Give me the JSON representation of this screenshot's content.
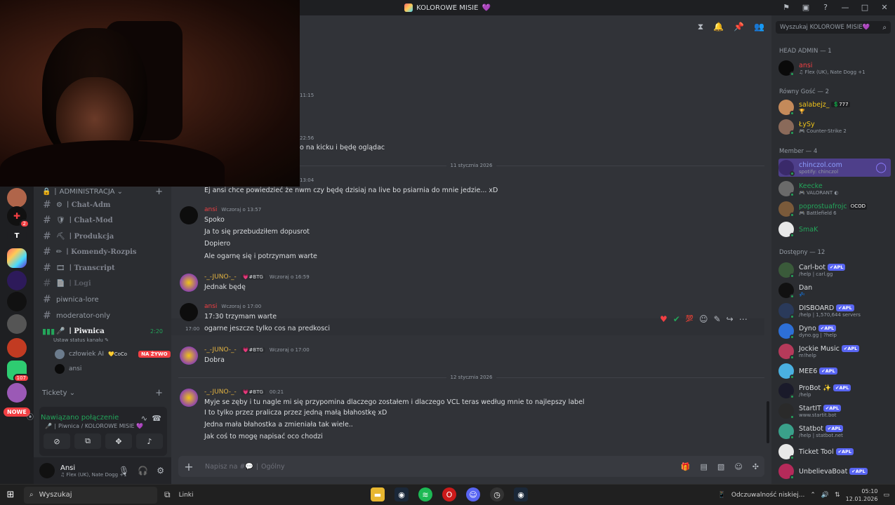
{
  "window": {
    "title": "KOLOROWE MISIE",
    "title_emoji": "💜"
  },
  "rail": {
    "badge_count": "2",
    "letter": "T",
    "badge_107": "107",
    "nowe_label": "NOWE"
  },
  "sidebar": {
    "category_admin": "ADMINISTRACJA",
    "channels": [
      {
        "label": "Chat-Adm",
        "emoji": "⚙"
      },
      {
        "label": "Chat-Mod",
        "emoji": "🛡"
      },
      {
        "label": "Produkcja",
        "emoji": "⛏"
      },
      {
        "label": "Komendy-Rozpis",
        "emoji": "✏"
      },
      {
        "label": "Transcript",
        "emoji": "🎞"
      },
      {
        "label": "Logi",
        "emoji": "📄"
      }
    ],
    "plain_channels": [
      "piwnica-lore",
      "moderator-only"
    ],
    "voice_channel": "Piwnica",
    "voice_timer": "2:20",
    "voice_status": "Ustaw status kanału",
    "voice_users": [
      {
        "name": "człowiek AI",
        "extra": "CoCo",
        "live": "NA ŻYWO"
      },
      {
        "name": "ansi"
      }
    ],
    "category_tickets": "Tickety"
  },
  "voice_panel": {
    "status": "Nawiązano połączenie",
    "location": "Piwnica / KOLOROWE MISIE"
  },
  "user_panel": {
    "name": "Ansi",
    "activity": "Flex (UK), Nate Dogg +1"
  },
  "chat": {
    "partial_ts_1": "11:15",
    "partial_ts_2": "22:56",
    "partial_text": "o na kicku i będę oglądac",
    "divider_1": "11 stycznia 2026",
    "partial_ts_3": "13:04",
    "msg1_text": "Ej ansi chce powiedzieć że nwm czy będę dzisiaj na live bo psiarnia do mnie jedzie... xD",
    "msg2_author": "ansi",
    "msg2_ts": "Wczoraj o 13:57",
    "msg2_lines": [
      "Spoko",
      "Ja to się przebudziłem dopusrot",
      "Dopiero",
      "Ale ogarnę się i potrzymam warte"
    ],
    "msg3_author": "-_-JUNO-_-",
    "msg3_tag": "#BTG",
    "msg3_ts": "Wczoraj o 16:59",
    "msg3_text": "Jednak będę",
    "msg4_author": "ansi",
    "msg4_ts": "Wczoraj o 17:00",
    "msg4_line1": "17:30 trzymam warte",
    "msg4_side_ts": "17:00",
    "msg4_line2": "ogarne jeszcze tylko cos na predkosci",
    "msg5_author": "-_-JUNO-_-",
    "msg5_tag": "#BTG",
    "msg5_ts": "Wczoraj o 17:00",
    "msg5_text": "Dobra",
    "divider_2": "12 stycznia 2026",
    "msg6_author": "-_-JUNO-_-",
    "msg6_tag": "#BTG",
    "msg6_ts": "00:21",
    "msg6_lines": [
      "Myje se zęby i tu nagle mi się przypomina dlaczego zostałem i dlaczego VCL teras według mnie to najlepszy label",
      "I to tylko przez pralicza przez jedną małą błahostkę xD",
      "Jedna mała błahostka a zmieniała tak wiele..",
      "Jak coś to mogę napisać oco chodzi"
    ],
    "composer_placeholder": "Napisz na #💬 ∣ Ogólny"
  },
  "members": {
    "search_placeholder": "Wyszukaj KOLOROWE MISIE💜",
    "groups": {
      "head_admin": "HEAD ADMIN — 1",
      "rowny": "Równy Gość — 2",
      "member": "Member — 4",
      "dostepny": "Dostępny — 12"
    },
    "list": [
      {
        "name": "ansi",
        "sub": "Flex (UK), Nate Dogg +1",
        "color": "#f23f43"
      },
      {
        "name": "salabejz_",
        "sub": "",
        "color": "#f0c419",
        "badge": "777"
      },
      {
        "name": "ŁySy",
        "sub": "Counter-Strike 2",
        "color": "#f0c419"
      },
      {
        "name": "chinczol.com",
        "sub": "spotify: chinczol",
        "color": "#5865f2"
      },
      {
        "name": "Keecke",
        "sub": "VALORANT",
        "color": "#23a55a"
      },
      {
        "name": "poprostuafrojc",
        "sub": "Battlefield 6",
        "color": "#23a55a",
        "badge": "COD"
      },
      {
        "name": "SmaK",
        "sub": "",
        "color": "#23a55a"
      },
      {
        "name": "Carl-bot",
        "sub": "/help | carl.gg",
        "color": "#dbdee1",
        "apl": "APL"
      },
      {
        "name": "Dan",
        "sub": "",
        "color": "#dbdee1"
      },
      {
        "name": "DISBOARD",
        "sub": "/help | 1,570,644 servers",
        "color": "#dbdee1",
        "apl": "APL"
      },
      {
        "name": "Dyno",
        "sub": "dyno.gg | ?help",
        "color": "#dbdee1",
        "apl": "APL"
      },
      {
        "name": "Jockie Music",
        "sub": "m!help",
        "color": "#dbdee1",
        "apl": "APL"
      },
      {
        "name": "MEE6",
        "sub": "",
        "color": "#dbdee1",
        "apl": "APL"
      },
      {
        "name": "ProBot",
        "sub": "/help",
        "color": "#dbdee1",
        "apl": "APL"
      },
      {
        "name": "StartIT",
        "sub": "www.startit.bot",
        "color": "#dbdee1",
        "apl": "APL"
      },
      {
        "name": "Statbot",
        "sub": "/help | statbot.net",
        "color": "#dbdee1",
        "apl": "APL"
      },
      {
        "name": "Ticket Tool",
        "sub": "",
        "color": "#dbdee1",
        "apl": "APL"
      },
      {
        "name": "UnbelievaBoat",
        "sub": "",
        "color": "#dbdee1",
        "apl": "APL"
      }
    ]
  },
  "taskbar": {
    "search": "Wyszukaj",
    "linki": "Linki",
    "notification": "Odczuwalność niskiej...",
    "time": "05:10",
    "date": "12.01.2026"
  }
}
